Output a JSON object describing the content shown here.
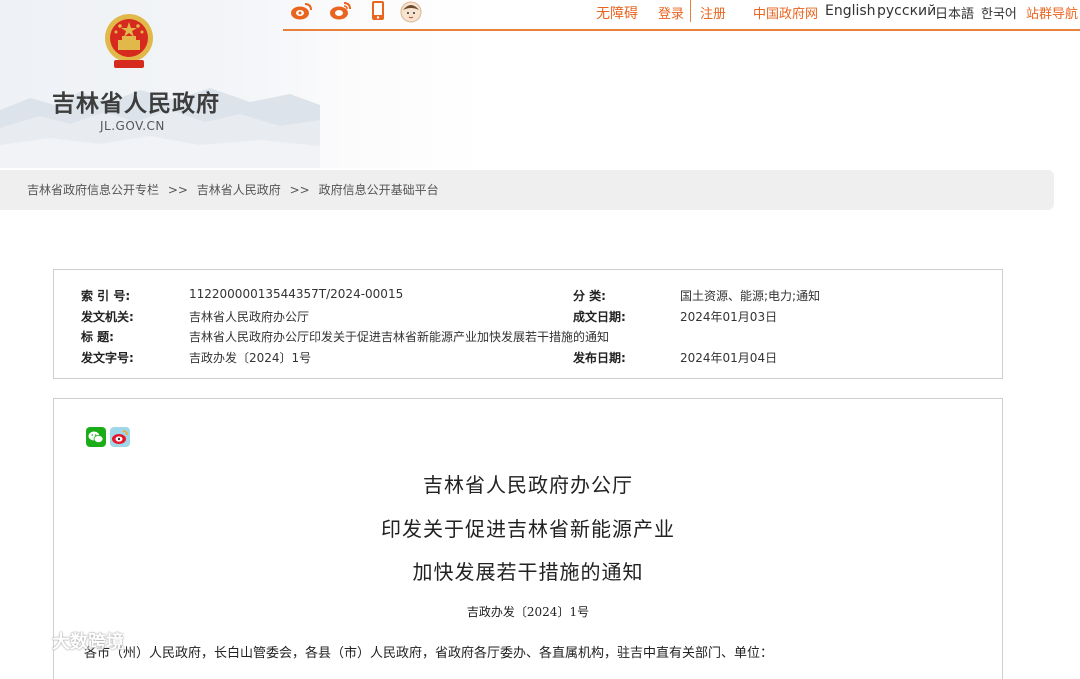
{
  "header": {
    "site_title": "吉林省人民政府",
    "site_domain": "JL.GOV.CN",
    "icons": [
      "weibo-icon",
      "weibo-alt-icon",
      "mobile-icon",
      "child-avatar-icon"
    ],
    "links": {
      "accessibility": "无障碍",
      "login": "登录",
      "register": "注册",
      "china_gov": "中国政府网",
      "english": "English",
      "russian": "русский",
      "japanese": "日本語",
      "korean": "한국어",
      "site_nav": "站群导航"
    },
    "accent_color": "#e9651f"
  },
  "breadcrumb": {
    "items": [
      "吉林省政府信息公开专栏",
      "吉林省人民政府",
      "政府信息公开基础平台"
    ],
    "separator": ">>"
  },
  "info": {
    "index_label": "索 引 号:",
    "index_value": "11220000013544357T/2024-00015",
    "category_label": "分    类:",
    "category_value": "国土资源、能源;电力;通知",
    "issuer_label": "发文机关:",
    "issuer_value": "吉林省人民政府办公厅",
    "date_label": "成文日期:",
    "date_value": "2024年01月03日",
    "title_label": "标    题:",
    "title_value": "吉林省人民政府办公厅印发关于促进吉林省新能源产业加快发展若干措施的通知",
    "docnum_label": "发文字号:",
    "docnum_value": "吉政办发〔2024〕1号",
    "publish_label": "发布日期:",
    "publish_value": "2024年01月04日"
  },
  "document": {
    "title_lines": [
      "吉林省人民政府办公厅",
      "印发关于促进吉林省新能源产业",
      "加快发展若干措施的通知"
    ],
    "doc_number": "吉政办发〔2024〕1号",
    "body_first_line": "各市（州）人民政府，长白山管委会，各县（市）人民政府，省政府各厅委办、各直属机构，驻吉中直有关部门、单位：",
    "share_icons": [
      "wechat-icon",
      "weibo-share-icon"
    ]
  },
  "watermark": {
    "text": "大数跨境"
  }
}
